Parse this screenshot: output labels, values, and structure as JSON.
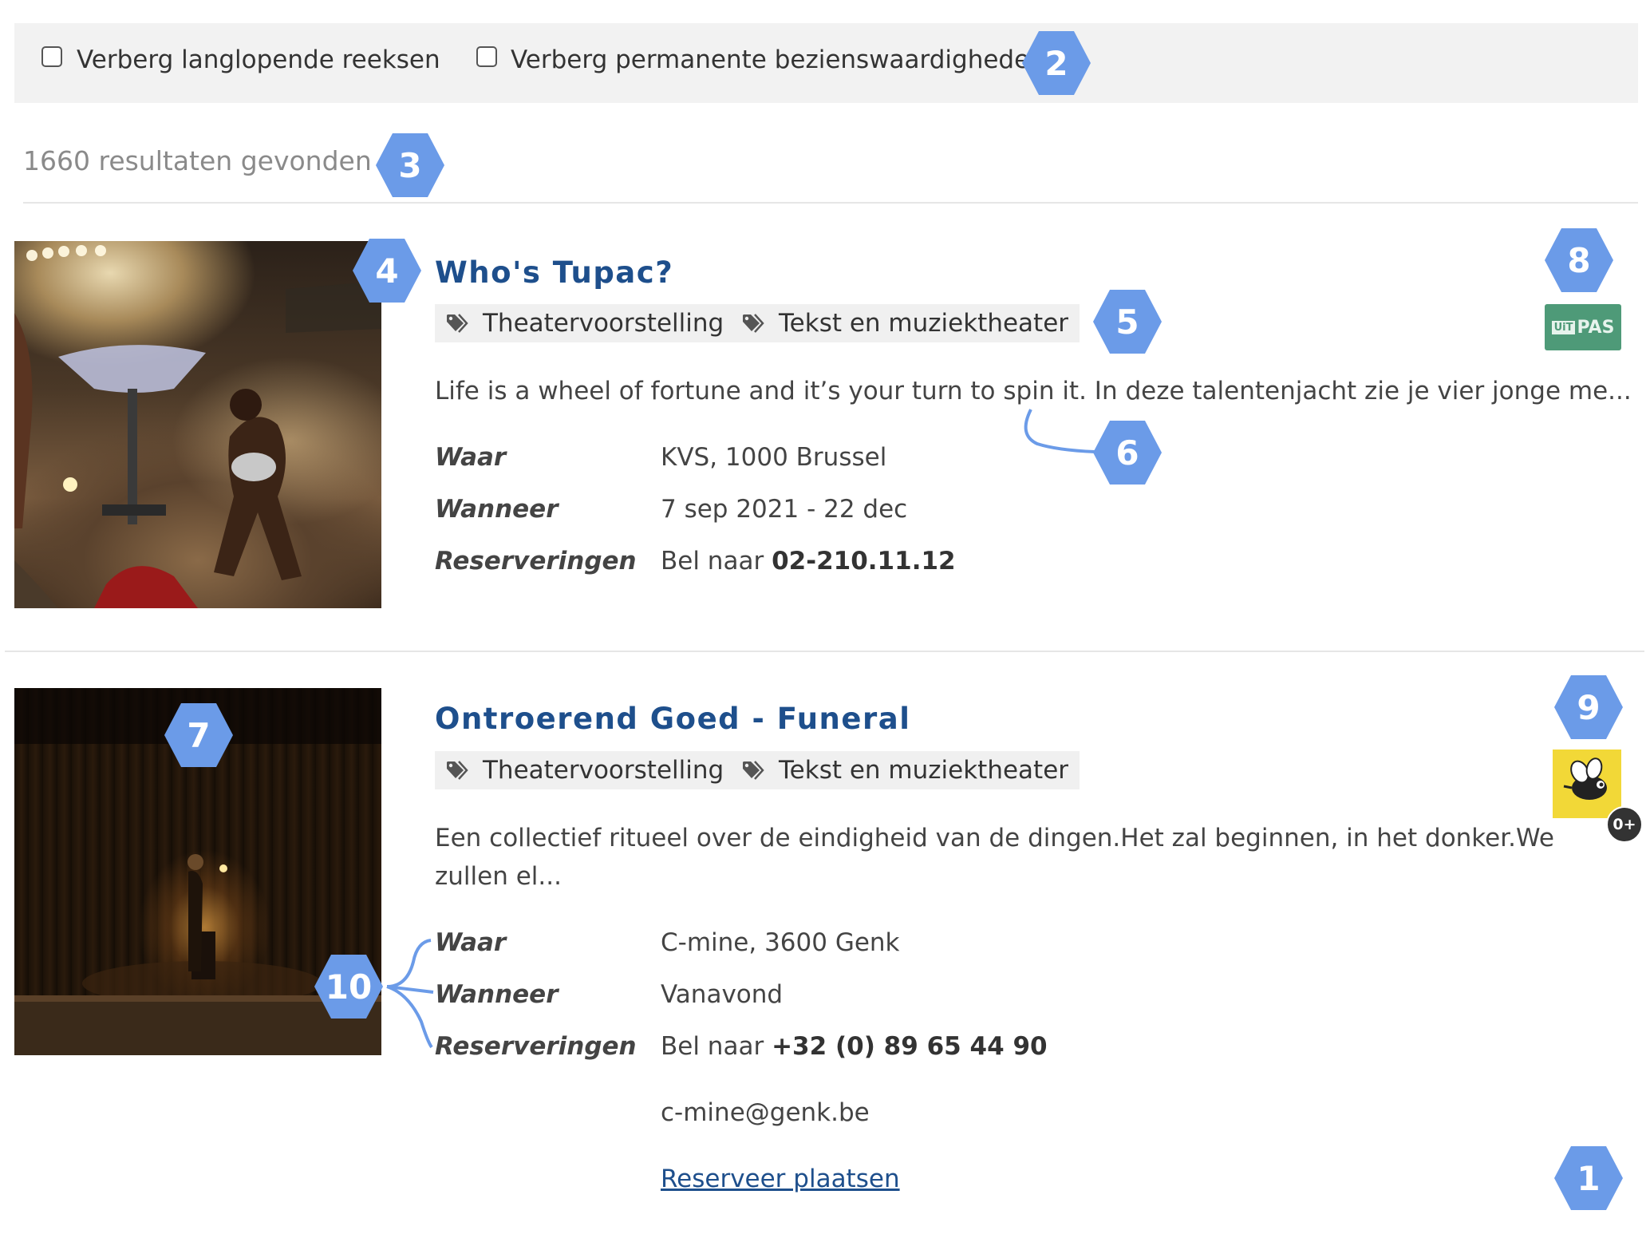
{
  "filters": {
    "hide_long_series": "Verberg langlopende reeksen",
    "hide_permanent": "Verberg permanente bezienswaardigheden"
  },
  "results_count": "1660 resultaten gevonden",
  "events": [
    {
      "title": "Who's Tupac?",
      "tags": [
        "Theatervoorstelling",
        "Tekst en muziektheater"
      ],
      "description": "Life is a wheel of fortune and it’s your turn to spin it. In deze talentenjacht zie je vier jonge me...",
      "where_label": "Waar",
      "where": "KVS, 1000 Brussel",
      "when_label": "Wanneer",
      "when": "7 sep 2021 - 22 dec",
      "reservations_label": "Reserveringen",
      "reservations_prefix": "Bel naar",
      "phone": "02-210.11.12",
      "badge_text_1": "UiT",
      "badge_text_2": "PAS"
    },
    {
      "title": "Ontroerend Goed - Funeral",
      "tags": [
        "Theatervoorstelling",
        "Tekst en muziektheater"
      ],
      "description_line1": "Een collectief ritueel over de eindigheid van de dingen.Het zal beginnen, in het donker.We",
      "description_line2": "zullen el...",
      "where_label": "Waar",
      "where": "C-mine, 3600 Genk",
      "when_label": "Wanneer",
      "when": "Vanavond",
      "reservations_label": "Reserveringen",
      "reservations_prefix": "Bel naar",
      "phone": "+32 (0) 89 65 44 90",
      "email": "c-mine@genk.be",
      "reserve_link": "Reserveer plaatsen",
      "age_badge": "0+"
    }
  ],
  "callouts": [
    "1",
    "2",
    "3",
    "4",
    "5",
    "6",
    "7",
    "8",
    "9",
    "10"
  ],
  "colors": {
    "accent": "#1e4f8c",
    "callout": "#6b9be8",
    "filter_bg": "#f2f2f2",
    "tag_bg": "#f0f0f0",
    "uitpas": "#4e9a78",
    "kids_badge": "#f2d837"
  },
  "icons": [
    "checkbox",
    "tag-icon",
    "uitpas-logo",
    "kids-bee-icon"
  ]
}
